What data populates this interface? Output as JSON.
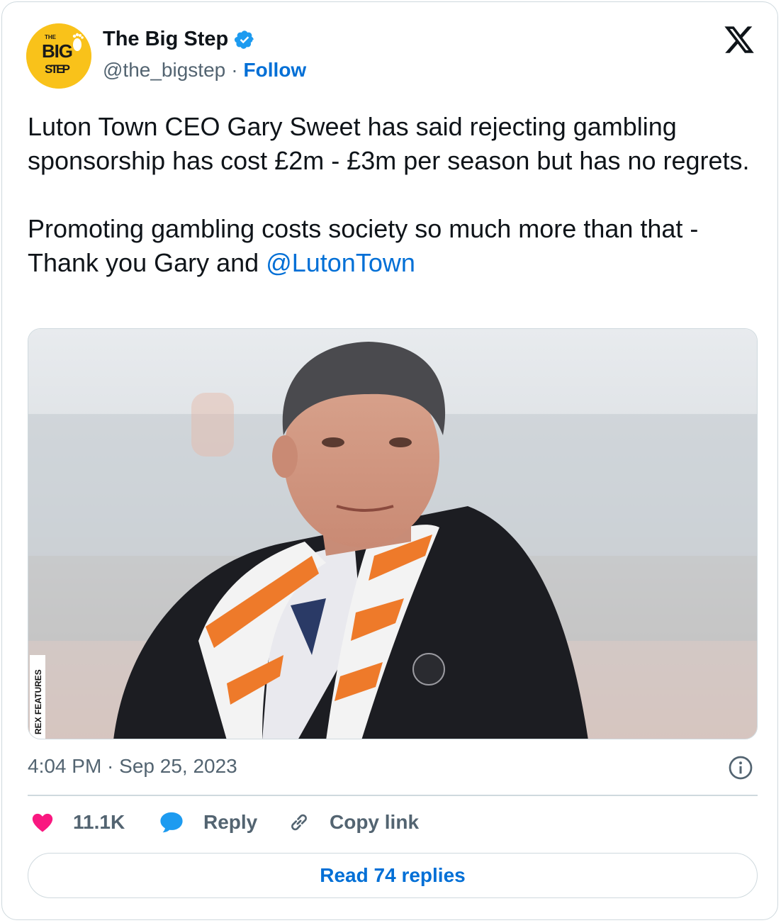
{
  "author": {
    "display_name": "The Big Step",
    "handle": "@the_bigstep",
    "separator": "·",
    "follow_label": "Follow",
    "verified": true,
    "avatar_lettering": [
      "THE",
      "BIG",
      "STEP"
    ]
  },
  "tweet": {
    "text_line1": "Luton Town CEO Gary Sweet has said rejecting gambling sponsorship has cost £2m - £3m per season but has no regrets.",
    "text_line2": "Promoting gambling costs society so much more than that - Thank you Gary and ",
    "mention": "@LutonTown"
  },
  "media": {
    "credit": "REX FEATURES"
  },
  "meta": {
    "timestamp": "4:04 PM · Sep 25, 2023"
  },
  "actions": {
    "likes": "11.1K",
    "reply_label": "Reply",
    "copy_label": "Copy link"
  },
  "read_replies_label": "Read 74 replies",
  "colors": {
    "link": "#006fd6",
    "text": "#0f1419",
    "muted": "#536471",
    "border": "#cfd9de",
    "like": "#f91880",
    "reply": "#1d9bf0",
    "avatar_bg": "#f9c21a"
  },
  "icons": [
    "verified-badge-icon",
    "x-logo-icon",
    "info-icon",
    "heart-icon",
    "reply-bubble-icon",
    "link-icon"
  ]
}
